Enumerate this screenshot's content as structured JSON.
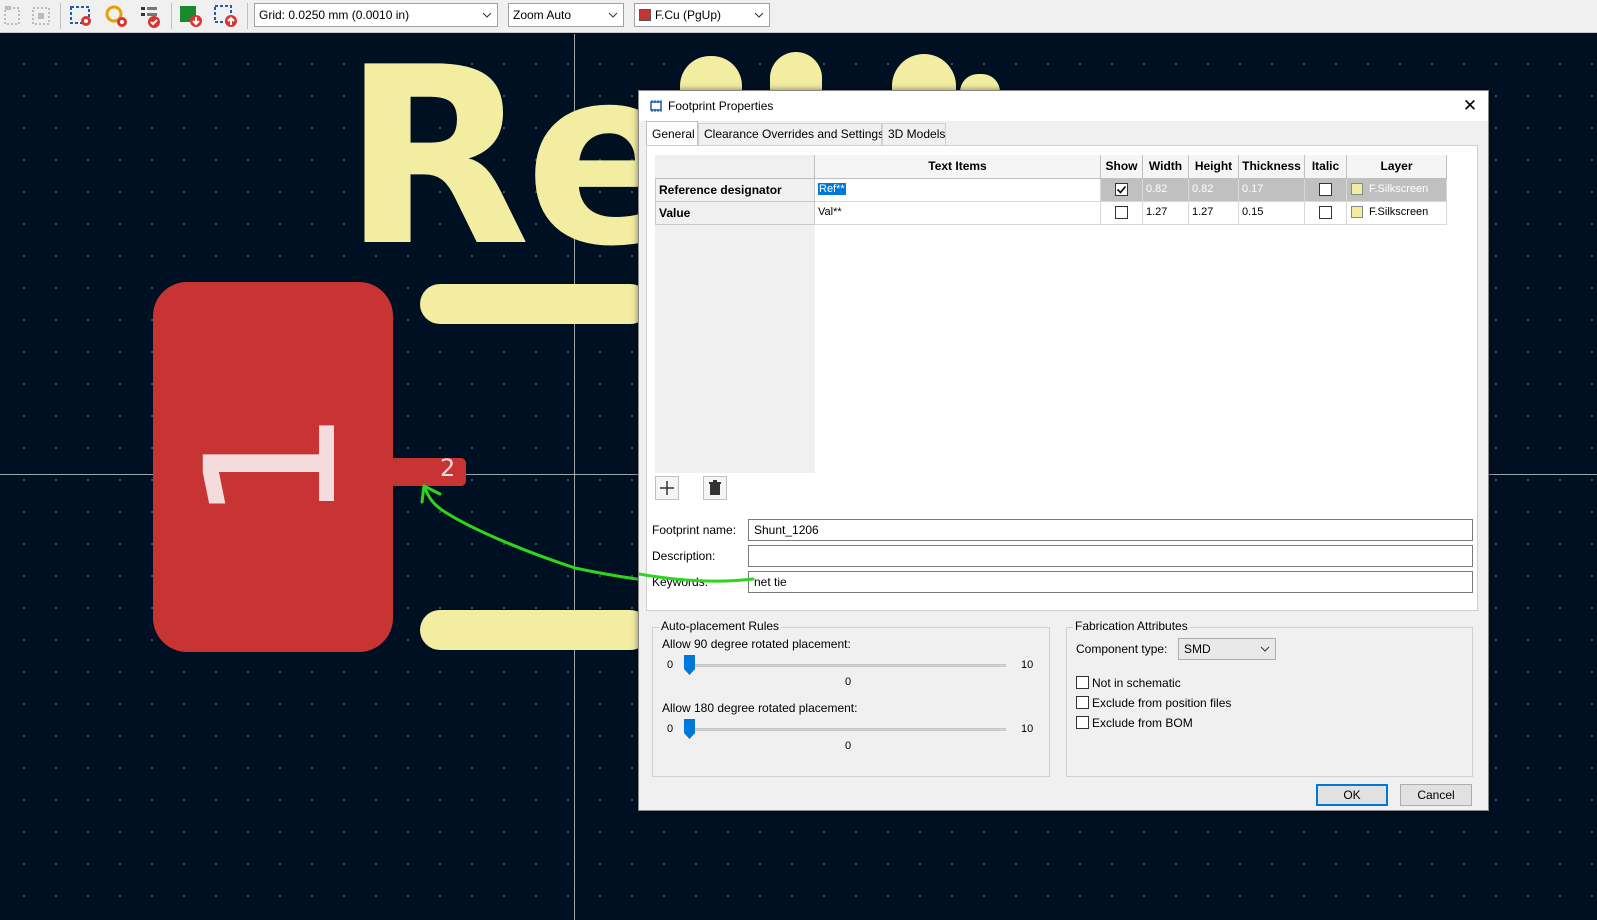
{
  "toolbar": {
    "grid_select": "Grid: 0.0250 mm (0.0010 in)",
    "zoom_select": "Zoom Auto",
    "layer_select": "F.Cu (PgUp)",
    "layer_color": "#c83434"
  },
  "canvas": {
    "pad1_label": "1",
    "pad2_label": "2",
    "ref_text": "Re",
    "pad_color": "#c83434",
    "silk_color": "#f2eda1",
    "annotation_color": "#2fd51c"
  },
  "dialog": {
    "title": "Footprint Properties",
    "tabs": [
      {
        "label": "General"
      },
      {
        "label": "Clearance Overrides and Settings"
      },
      {
        "label": "3D Models"
      }
    ],
    "table": {
      "headers": [
        "Text Items",
        "Show",
        "Width",
        "Height",
        "Thickness",
        "Italic",
        "Layer"
      ],
      "rows": [
        {
          "label": "Reference designator",
          "text": "Ref**",
          "show": true,
          "width": "0.82",
          "height": "0.82",
          "thickness": "0.17",
          "italic": false,
          "layer": "F.Silkscreen"
        },
        {
          "label": "Value",
          "text": "Val**",
          "show": false,
          "width": "1.27",
          "height": "1.27",
          "thickness": "0.15",
          "italic": false,
          "layer": "F.Silkscreen"
        }
      ]
    },
    "footprint_name_label": "Footprint name:",
    "footprint_name": "Shunt_1206",
    "description_label": "Description:",
    "description": "",
    "keywords_label": "Keywords:",
    "keywords": "net tie",
    "auto_placement": {
      "title": "Auto-placement Rules",
      "rot90_label": "Allow 90 degree rotated placement:",
      "rot90_min": "0",
      "rot90_max": "10",
      "rot90_value": "0",
      "rot180_label": "Allow 180 degree rotated placement:",
      "rot180_min": "0",
      "rot180_max": "10",
      "rot180_value": "0"
    },
    "fabrication": {
      "title": "Fabrication Attributes",
      "component_type_label": "Component type:",
      "component_type": "SMD",
      "not_in_schematic": "Not in schematic",
      "exclude_position": "Exclude from position files",
      "exclude_bom": "Exclude from BOM"
    },
    "ok_label": "OK",
    "cancel_label": "Cancel"
  }
}
